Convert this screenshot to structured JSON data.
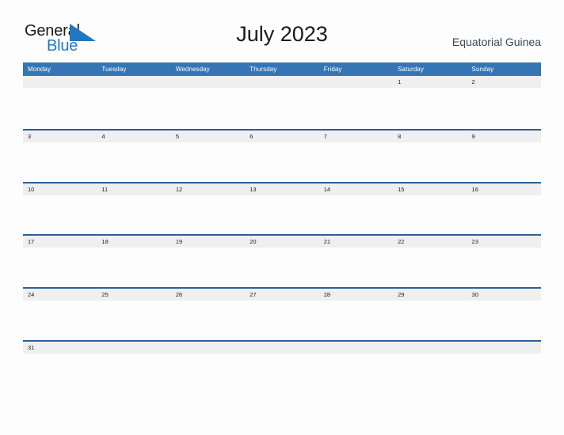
{
  "brand": {
    "word_one": "General",
    "word_two": "Blue",
    "flag_color": "#1f78c1",
    "word_one_color": "#1a1a1a",
    "word_two_color": "#1f78c1"
  },
  "header": {
    "title": "July 2023",
    "region": "Equatorial Guinea"
  },
  "colors": {
    "header_blue": "#3575b5",
    "row_line_blue": "#2a6099",
    "date_band_gray": "#efefef",
    "page_background": "#fdfdfd"
  },
  "calendar": {
    "weekday_headers": [
      "Monday",
      "Tuesday",
      "Wednesday",
      "Thursday",
      "Friday",
      "Saturday",
      "Sunday"
    ],
    "weeks": [
      [
        "",
        "",
        "",
        "",
        "",
        "1",
        "2"
      ],
      [
        "3",
        "4",
        "5",
        "6",
        "7",
        "8",
        "9"
      ],
      [
        "10",
        "11",
        "12",
        "13",
        "14",
        "15",
        "16"
      ],
      [
        "17",
        "18",
        "19",
        "20",
        "21",
        "22",
        "23"
      ],
      [
        "24",
        "25",
        "26",
        "27",
        "28",
        "29",
        "30"
      ],
      [
        "31",
        "",
        "",
        "",
        "",
        "",
        ""
      ]
    ]
  }
}
